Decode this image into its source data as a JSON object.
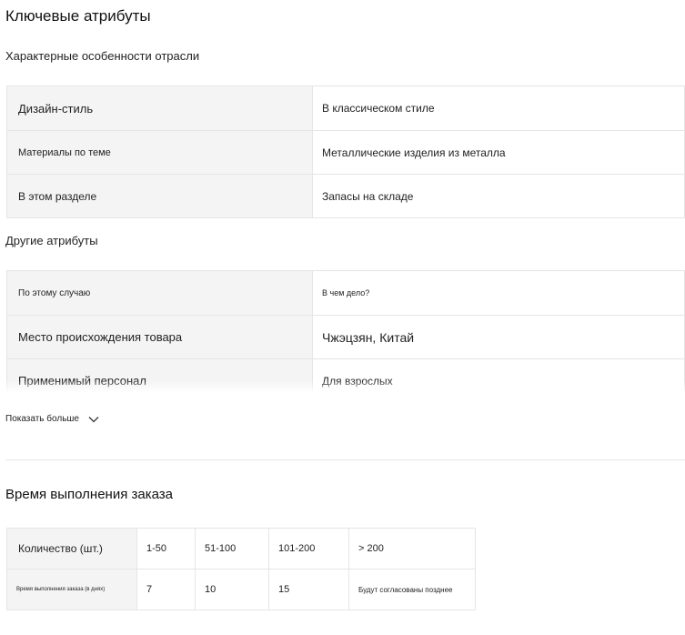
{
  "key_attributes": {
    "title": "Ключевые атрибуты",
    "industry_title": "Характерные особенности отрасли",
    "industry_rows": [
      {
        "label": "Дизайн-стиль",
        "value": "В классическом стиле"
      },
      {
        "label": "Материалы по теме",
        "value": "Металлические изделия из металла"
      },
      {
        "label": "В этом разделе",
        "value": "Запасы на складе"
      }
    ],
    "other_title": "Другие атрибуты",
    "other_rows": [
      {
        "label": "По этому случаю",
        "value": "В чем дело?"
      },
      {
        "label": "Место происхождения товара",
        "value": "Чжэцзян, Китай"
      },
      {
        "label": "Применимый персонал",
        "value": "Для взрослых"
      }
    ],
    "show_more": "Показать больше"
  },
  "lead_time": {
    "title": "Время выполнения заказа",
    "quantity_row": [
      "Количество (шт.)",
      "1-50",
      "51-100",
      "101-200",
      "> 200"
    ],
    "time_row": [
      "Время выполнения заказа (в днях)",
      "7",
      "10",
      "15",
      "Будут согласованы позднее"
    ]
  }
}
